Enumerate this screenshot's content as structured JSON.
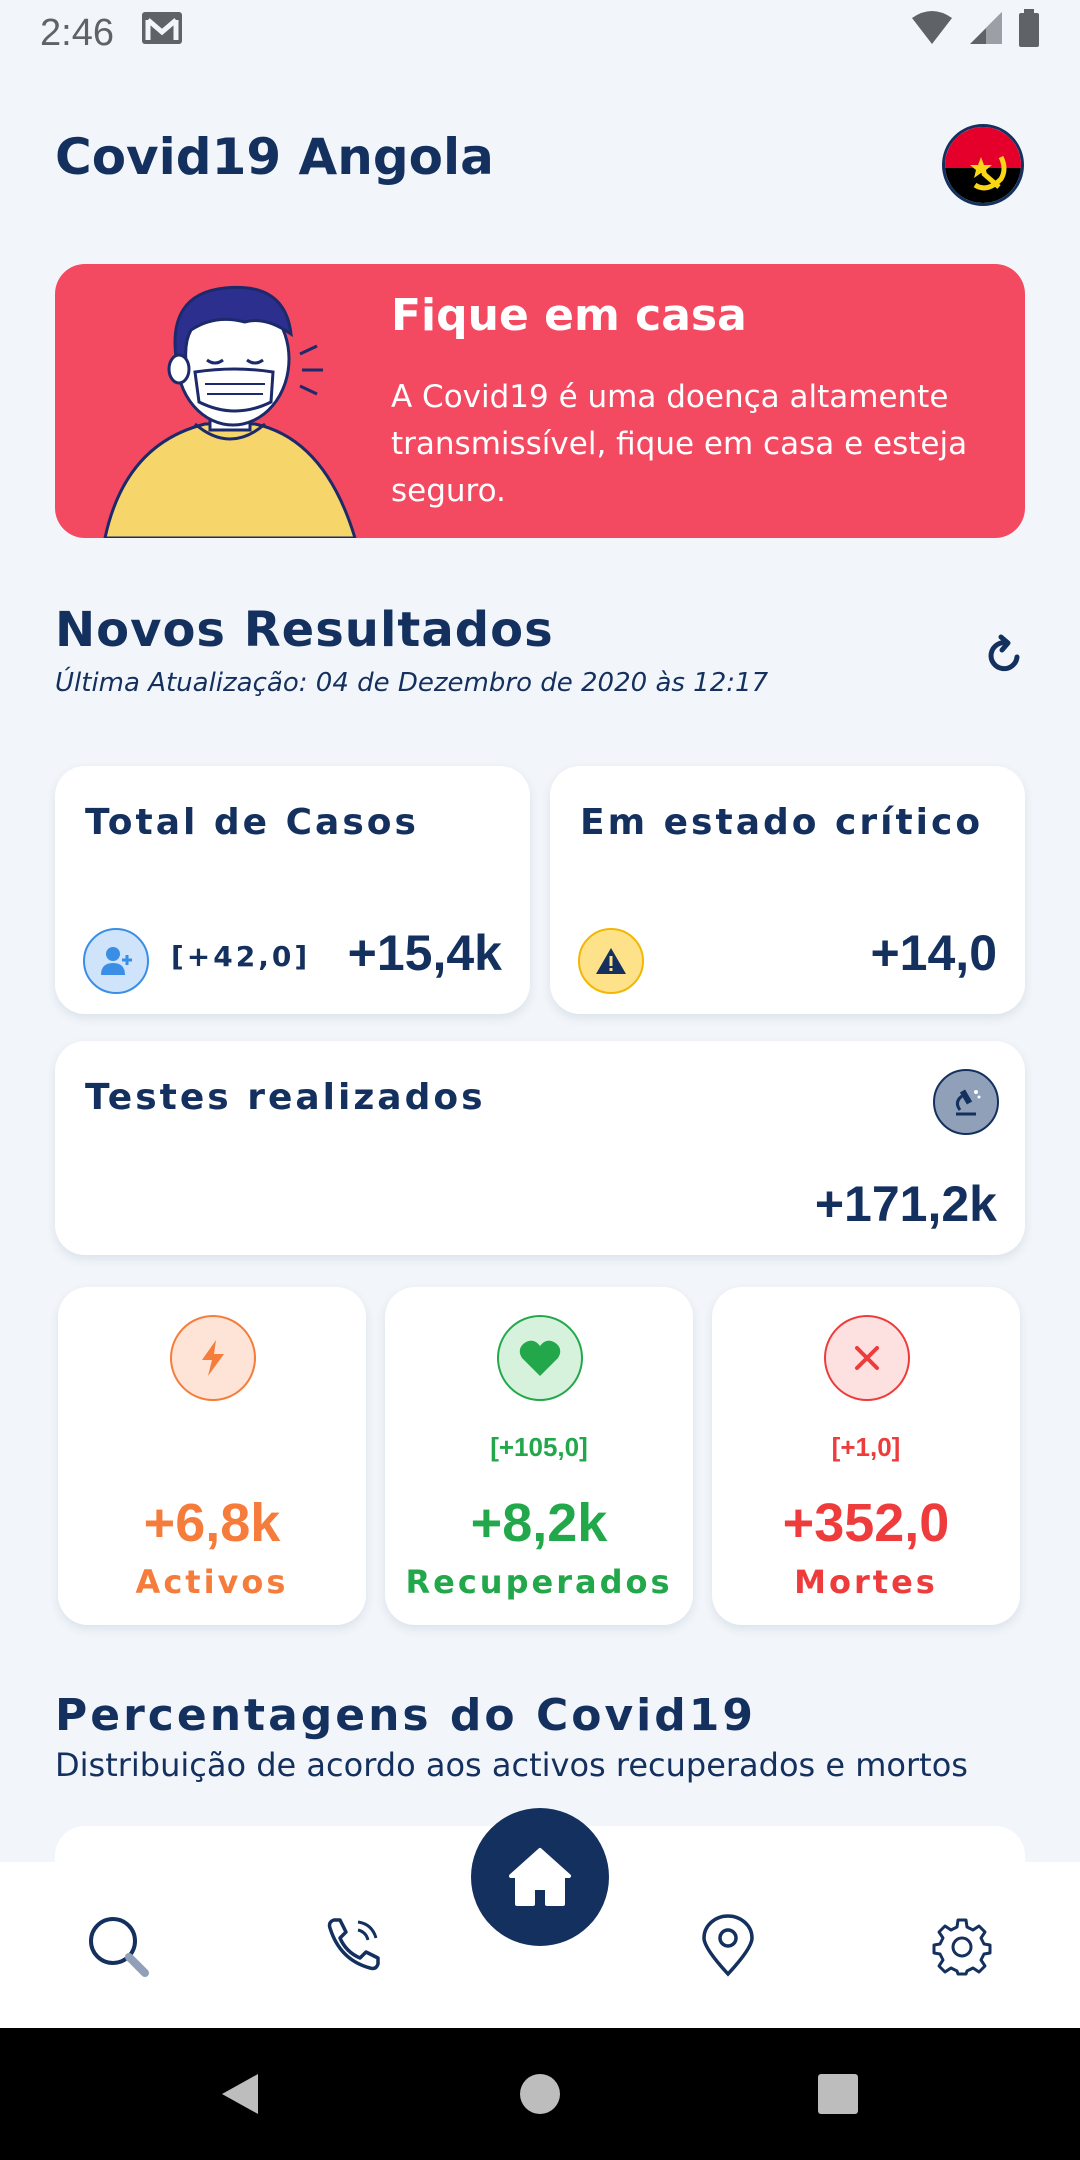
{
  "status_bar": {
    "time": "2:46"
  },
  "header": {
    "title": "Covid19 Angola"
  },
  "banner": {
    "title": "Fique em casa",
    "text": "A Covid19 é uma doença altamente transmissível, fique em casa e esteja seguro."
  },
  "results": {
    "title": "Novos Resultados",
    "last_update": "Última Atualização: 04 de Dezembro de 2020 às 12:17"
  },
  "cards": {
    "total_cases": {
      "label": "Total de Casos",
      "delta": "[+42,0]",
      "value": "+15,4k"
    },
    "critical": {
      "label": "Em estado crítico",
      "value": "+14,0"
    },
    "tests": {
      "label": "Testes realizados",
      "value": "+171,2k"
    },
    "active": {
      "label": "Activos",
      "value": "+6,8k",
      "color": "#f57c3a"
    },
    "recovered": {
      "label": "Recuperados",
      "delta": "[+105,0]",
      "value": "+8,2k",
      "color": "#22a84a"
    },
    "deaths": {
      "label": "Mortes",
      "delta": "[+1,0]",
      "value": "+352,0",
      "color": "#ee3b3b"
    }
  },
  "percentages": {
    "title": "Percentagens do Covid19",
    "subtitle": "Distribuição de acordo aos activos recuperados e mortos"
  },
  "bottom_nav": {
    "items": [
      "search-icon",
      "phone-icon",
      "home-icon",
      "location-icon",
      "settings-icon"
    ]
  },
  "colors": {
    "primary": "#14305e",
    "banner": "#f34a62",
    "background": "#f2f6fa"
  }
}
